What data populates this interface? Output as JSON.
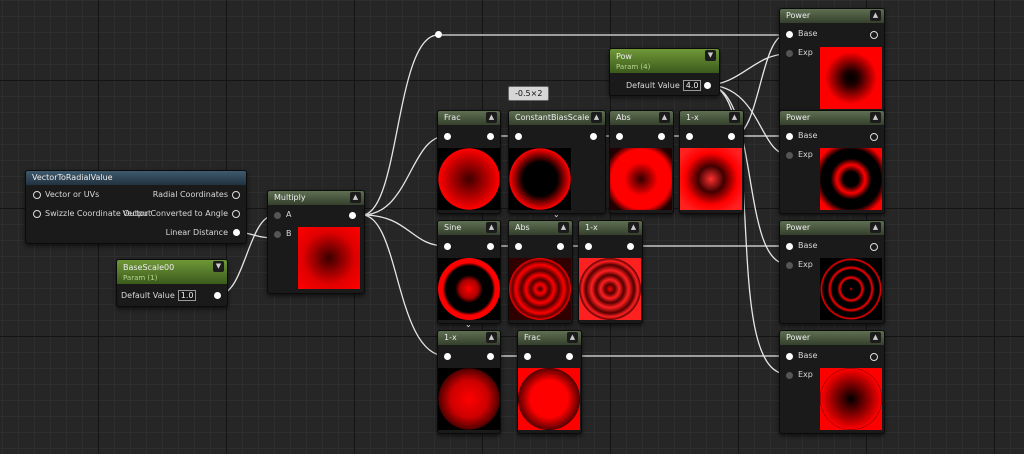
{
  "nodes": {
    "vector_to_radial": {
      "title": "VectorToRadialValue",
      "inputs": [
        "Vector or UVs",
        "Swizzle Coordinate Output"
      ],
      "outputs": [
        "Radial Coordinates",
        "Vector Converted to Angle",
        "Linear Distance"
      ]
    },
    "base_scale": {
      "title": "BaseScale00",
      "subtitle": "Param (1)",
      "default_label": "Default Value",
      "default_value": "1.0"
    },
    "multiply": {
      "title": "Multiply",
      "inputs": [
        "A",
        "B"
      ]
    },
    "pow_param": {
      "title": "Pow",
      "subtitle": "Param (4)",
      "default_label": "Default Value",
      "default_value": "4.0"
    },
    "frac1": {
      "title": "Frac"
    },
    "cbs": {
      "title": "ConstantBiasScale",
      "tooltip": "-0.5×2"
    },
    "abs1": {
      "title": "Abs"
    },
    "onex1": {
      "title": "1-x"
    },
    "sine": {
      "title": "Sine"
    },
    "abs2": {
      "title": "Abs"
    },
    "onex2": {
      "title": "1-x"
    },
    "onex3": {
      "title": "1-x"
    },
    "frac2": {
      "title": "Frac"
    },
    "power1": {
      "title": "Power",
      "inputs": [
        "Base",
        "Exp"
      ]
    },
    "power2": {
      "title": "Power",
      "inputs": [
        "Base",
        "Exp"
      ]
    },
    "power3": {
      "title": "Power",
      "inputs": [
        "Base",
        "Exp"
      ]
    },
    "power4": {
      "title": "Power",
      "inputs": [
        "Base",
        "Exp"
      ]
    }
  },
  "icons": {
    "collapse": "chevron-up-icon",
    "expand": "chevron-down-icon",
    "pin": "pin-icon"
  },
  "colors": {
    "preview_red": "#ff0000",
    "wire": "#e6e6e6",
    "material_header": "#5e6f52",
    "function_header": "#3e5a6e",
    "param_header": "#6f9838"
  }
}
